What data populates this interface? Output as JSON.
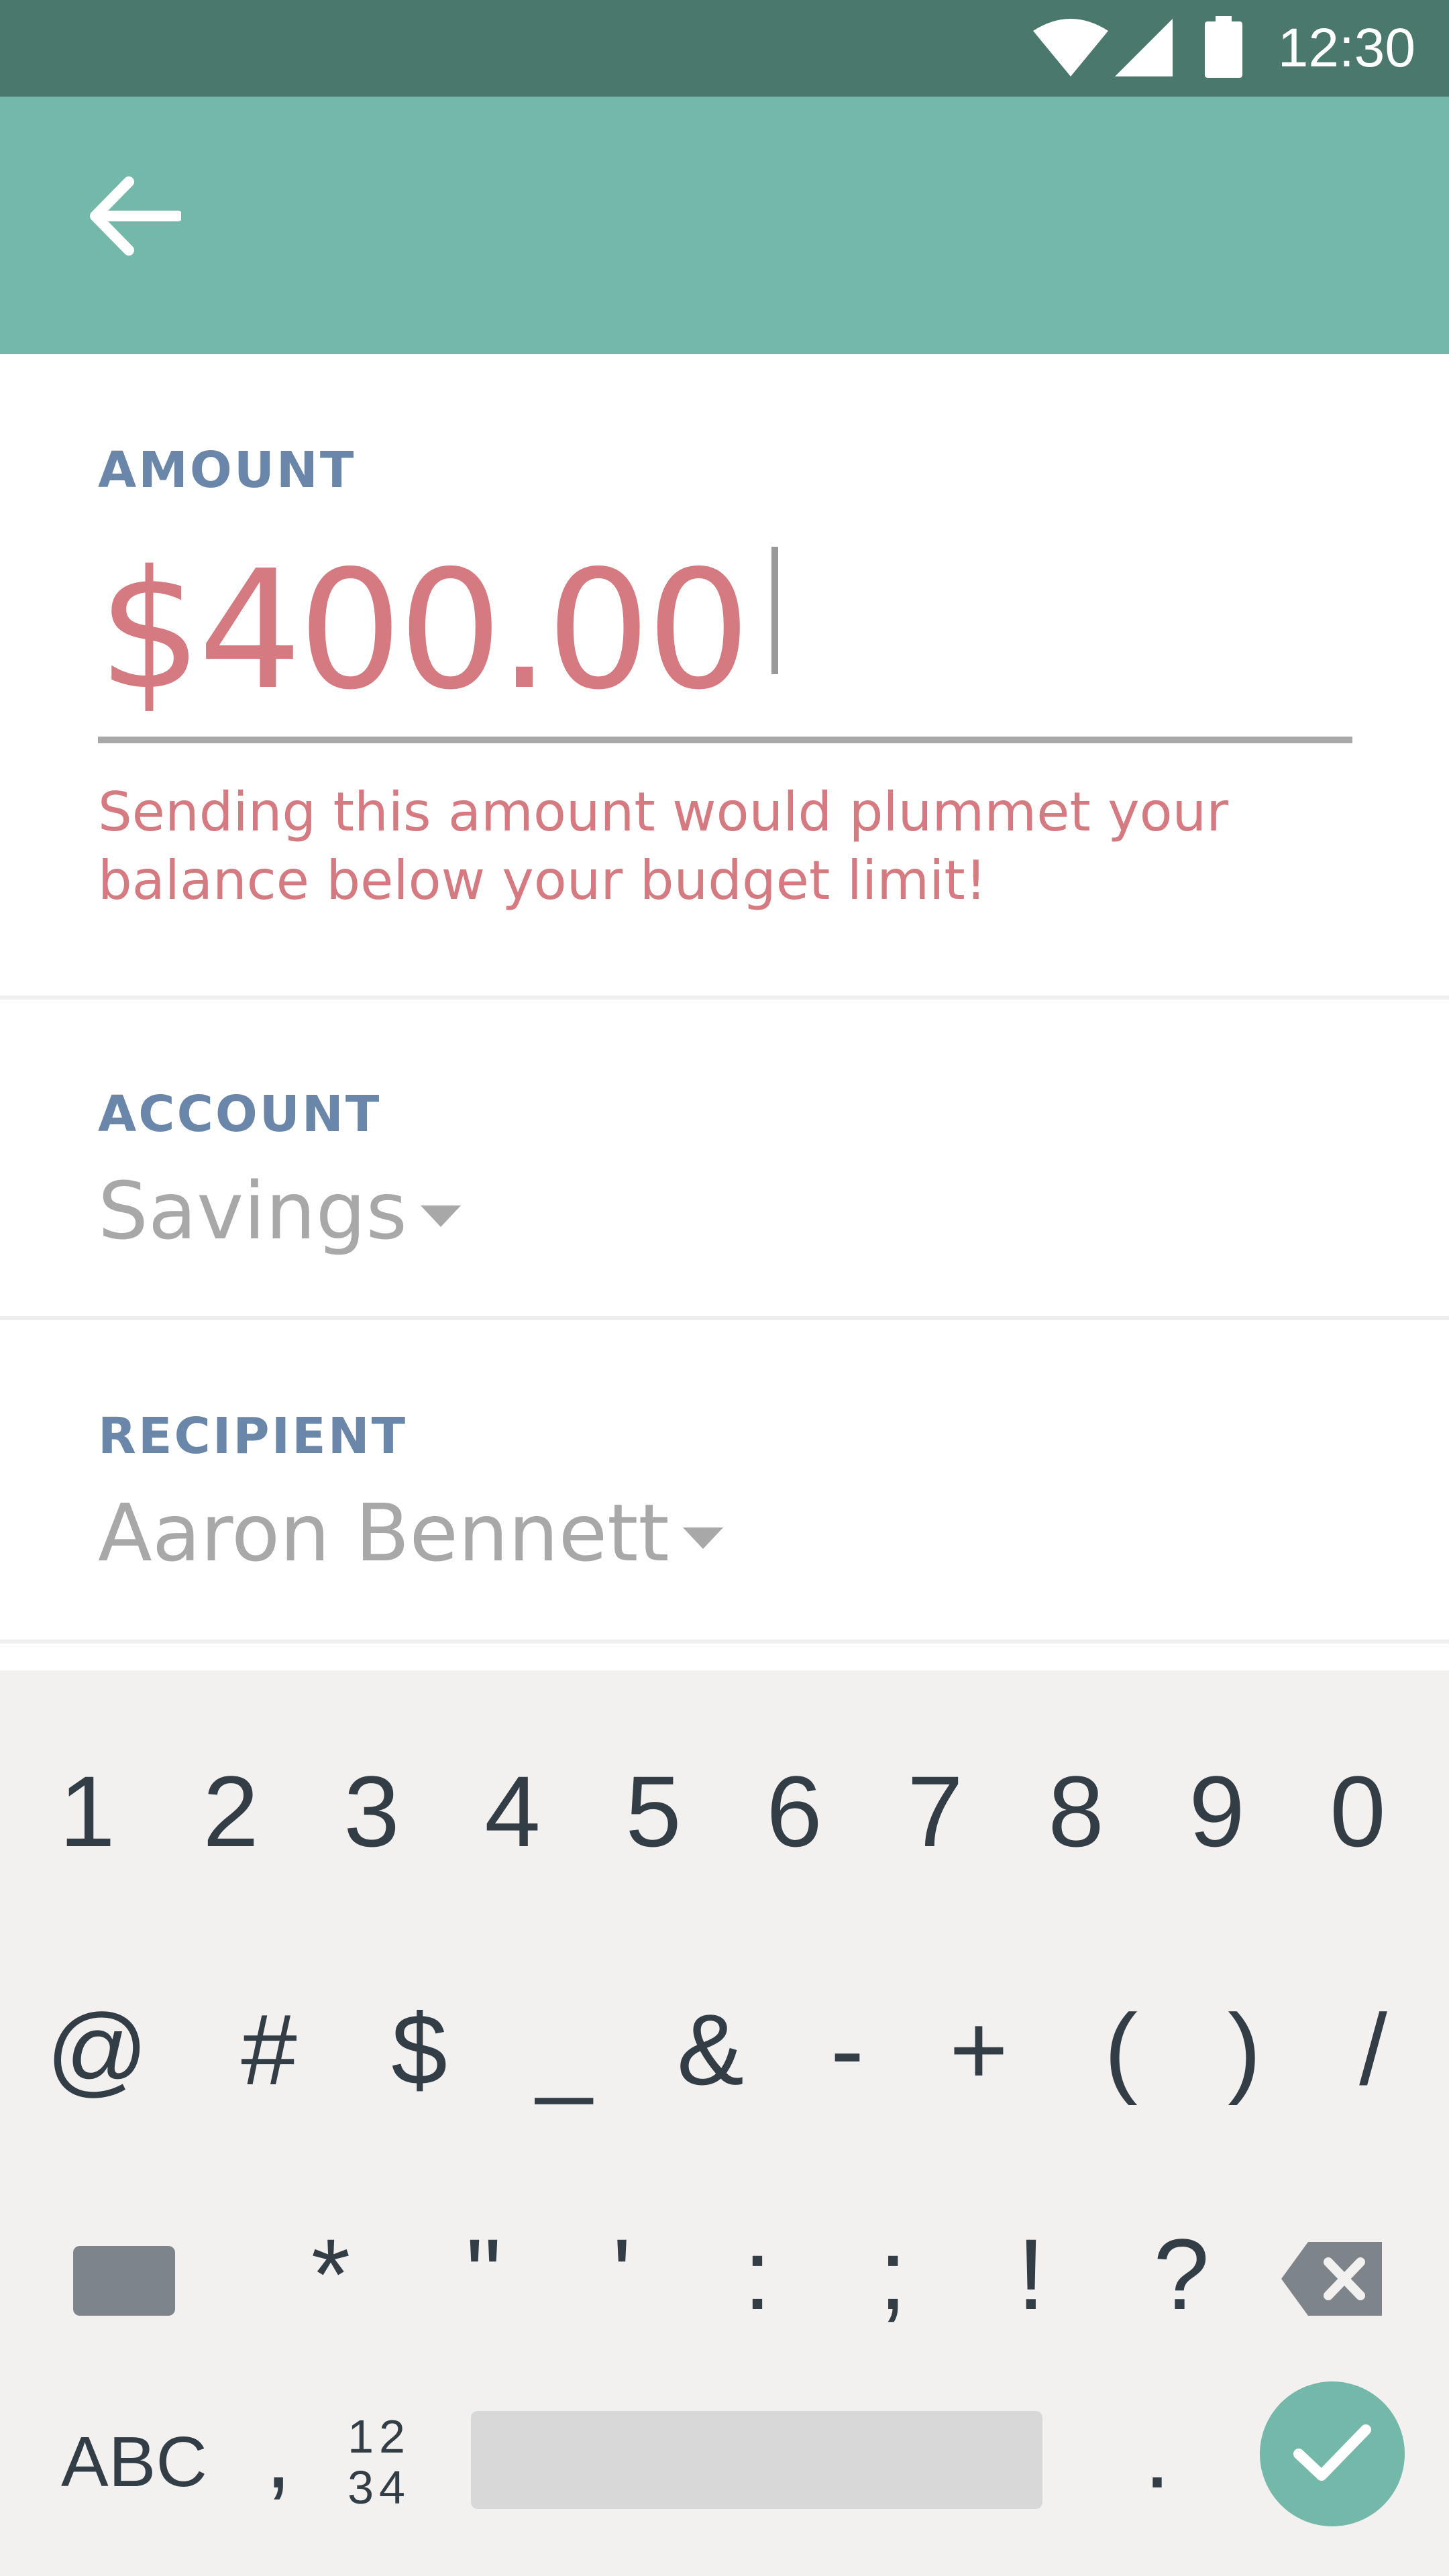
{
  "status_bar": {
    "time": "12:30",
    "icons": [
      "wifi-icon",
      "signal-icon",
      "battery-icon"
    ],
    "background": "#4a786c"
  },
  "app_bar": {
    "back_icon": "arrow-left-icon",
    "background": "#73b8a8"
  },
  "amount": {
    "label": "AMOUNT",
    "value": "$400.00",
    "error": "Sending this amount would plummet your balance below your budget limit!"
  },
  "account": {
    "label": "ACCOUNT",
    "value": "Savings"
  },
  "recipient": {
    "label": "RECIPIENT",
    "value": "Aaron Bennett"
  },
  "keyboard": {
    "row1": [
      "1",
      "2",
      "3",
      "4",
      "5",
      "6",
      "7",
      "8",
      "9",
      "0"
    ],
    "row2": [
      "@",
      "#",
      "$",
      "_",
      "&",
      "-",
      "+",
      "(",
      ")",
      "/"
    ],
    "row3": [
      "*",
      "\"",
      "'",
      ":",
      ";",
      "!",
      "?"
    ],
    "abc": "ABC",
    "comma": ",",
    "num_toggle_top": "12",
    "num_toggle_bottom": "34",
    "period": ".",
    "done_icon": "check-icon"
  },
  "colors": {
    "accent": "#73b8a8",
    "error": "#d47a80",
    "label": "#6a86a8",
    "muted": "#a8a8a8"
  }
}
